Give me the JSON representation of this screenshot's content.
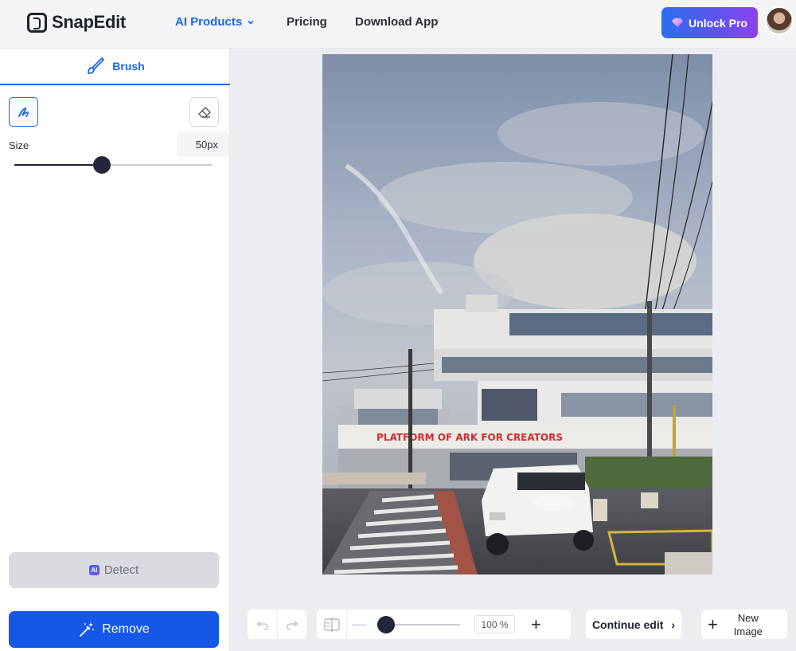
{
  "header": {
    "logo_text": "SnapEdit",
    "nav": {
      "ai_products": "AI Products",
      "pricing": "Pricing",
      "download": "Download App"
    },
    "unlock_label": "Unlock Pro"
  },
  "sidebar": {
    "tab_label": "Brush",
    "size_label": "Size",
    "size_value": "50px",
    "size_slider_fraction": 0.44,
    "detect_label": "Detect",
    "detect_badge": "AI",
    "remove_label": "Remove"
  },
  "photo": {
    "sign_text": "PLATFORM OF ARK FOR CREATORS"
  },
  "toolbar": {
    "zoom_value": "100 %",
    "zoom_slider_fraction": 0.0,
    "continue_label": "Continue edit",
    "continue_chevron": "›",
    "new_image_label": "New Image"
  },
  "colors": {
    "accent": "#1a66e6",
    "remove_button": "#1558e8",
    "unlock_gradient_start": "#2a6ef0",
    "unlock_gradient_end": "#8c43e8"
  }
}
